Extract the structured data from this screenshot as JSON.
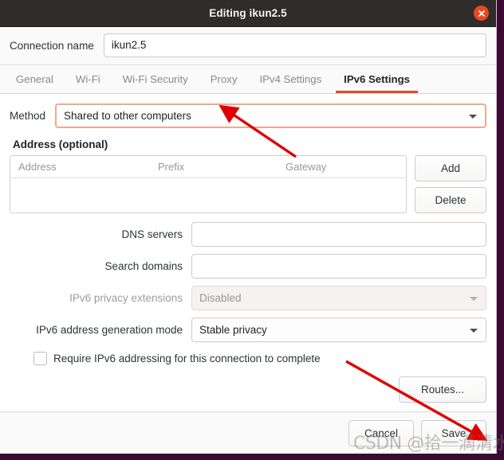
{
  "window": {
    "title": "Editing ikun2.5",
    "close_icon": "close-icon"
  },
  "connection": {
    "label": "Connection name",
    "value": "ikun2.5"
  },
  "tabs": [
    {
      "label": "General",
      "active": false
    },
    {
      "label": "Wi-Fi",
      "active": false
    },
    {
      "label": "Wi-Fi Security",
      "active": false
    },
    {
      "label": "Proxy",
      "active": false
    },
    {
      "label": "IPv4 Settings",
      "active": false
    },
    {
      "label": "IPv6 Settings",
      "active": true
    }
  ],
  "method": {
    "label": "Method",
    "value": "Shared to other computers",
    "caret_icon": "chevron-down-icon"
  },
  "address": {
    "section_title": "Address (optional)",
    "columns": [
      "Address",
      "Prefix",
      "Gateway"
    ],
    "rows": [],
    "add_label": "Add",
    "delete_label": "Delete"
  },
  "fields": {
    "dns_label": "DNS servers",
    "dns_value": "",
    "search_label": "Search domains",
    "search_value": "",
    "privacy_label": "IPv6 privacy extensions",
    "privacy_value": "Disabled",
    "genmode_label": "IPv6 address generation mode",
    "genmode_value": "Stable privacy"
  },
  "require": {
    "label": "Require IPv6 addressing for this connection to complete",
    "checked": false
  },
  "routes": {
    "label": "Routes..."
  },
  "actions": {
    "cancel_label": "Cancel",
    "save_label": "Save"
  },
  "watermark": {
    "text": "CSDN @拾一滴清水"
  },
  "colors": {
    "accent": "#e8491f",
    "titlebar": "#2f2c2b",
    "focus_border": "#efaa8b",
    "annotation_arrow": "#e00000",
    "desktop": "#3b0a33"
  }
}
